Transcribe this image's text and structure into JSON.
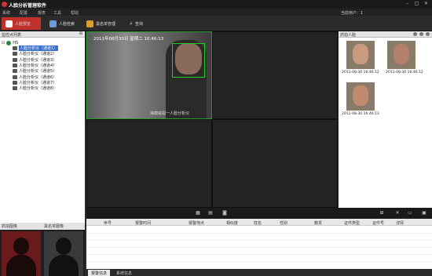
{
  "window": {
    "title": "人脸分析管理软件",
    "user_label": "当前用户：1"
  },
  "menu": [
    "系统",
    "配置",
    "报表",
    "工具",
    "帮助"
  ],
  "toolbar": {
    "items": [
      {
        "label": "人脸预览"
      },
      {
        "label": "人脸检索"
      },
      {
        "label": "黑名单管理"
      },
      {
        "label": "查询"
      }
    ]
  },
  "device_list": {
    "header": "监控点列表",
    "root": "HS",
    "channels": [
      "人脸分析仪（通道1）",
      "人脸分析仪（通道2）",
      "人脸分析仪（通道3）",
      "人脸分析仪（通道4）",
      "人脸分析仪（通道5）",
      "人脸分析仪（通道6）",
      "人脸分析仪（通道7）",
      "人脸分析仪（通道8）"
    ]
  },
  "bottom_left": {
    "tabs": [
      "抓拍图像",
      "黑名单图像"
    ]
  },
  "video": {
    "timestamp": "2011年08月30日 星期二 16:46:13",
    "caption": "海康威视一人脸分析仪"
  },
  "captures": {
    "header": "抓拍人脸",
    "items": [
      {
        "time": "2011-08-30 16:46:12"
      },
      {
        "time": "2011-08-30 16:46:12"
      },
      {
        "time": "2011-08-30 16:46:13"
      }
    ]
  },
  "alarm_table": {
    "columns": [
      "序号",
      "报警时间",
      "报警地点",
      "相似度",
      "姓名",
      "性别",
      "籍贯",
      "证件类型",
      "证件号",
      "详情"
    ]
  },
  "bottom_tabs": [
    "报警信息",
    "系统信息"
  ],
  "colors": {
    "accent": "#c0302c",
    "face_box": "#22cc22"
  }
}
